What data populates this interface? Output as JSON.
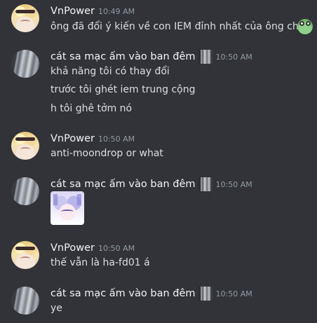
{
  "messages": [
    {
      "author": "VnPower",
      "avatar": "vnpower-avatar",
      "time": "10:49 AM",
      "lines": [
        "ông đã đổi ý kiến về con IEM đỉnh nhất của ông chưa"
      ],
      "emoji": "frog-emoji"
    },
    {
      "author": "cát sa mạc ấm vào ban đêm",
      "avatar": "cat-avatar",
      "role_icon": "role-icon",
      "time": "10:50 AM",
      "lines": [
        "khả năng tôi có thay đổi",
        "trước tôi ghét iem trung cộng",
        "h tôi ghê tởm nó"
      ]
    },
    {
      "author": "VnPower",
      "avatar": "vnpower-avatar",
      "time": "10:50 AM",
      "lines": [
        "anti-moondrop or what"
      ]
    },
    {
      "author": "cát sa mạc ấm vào ban đêm",
      "avatar": "cat-avatar",
      "role_icon": "role-icon",
      "time": "10:50 AM",
      "sticker": "anime-girl-sticker"
    },
    {
      "author": "VnPower",
      "avatar": "vnpower-avatar",
      "time": "10:50 AM",
      "lines": [
        "thế vẫn là ha-fd01 á"
      ]
    },
    {
      "author": "cát sa mạc ấm vào ban đêm",
      "avatar": "cat-avatar",
      "role_icon": "role-icon",
      "time": "10:50 AM",
      "lines": [
        "ye"
      ]
    }
  ],
  "colors": {
    "background": "#313338",
    "username": "#f2f3f5",
    "text": "#dbdee1",
    "timestamp": "#949ba4"
  }
}
